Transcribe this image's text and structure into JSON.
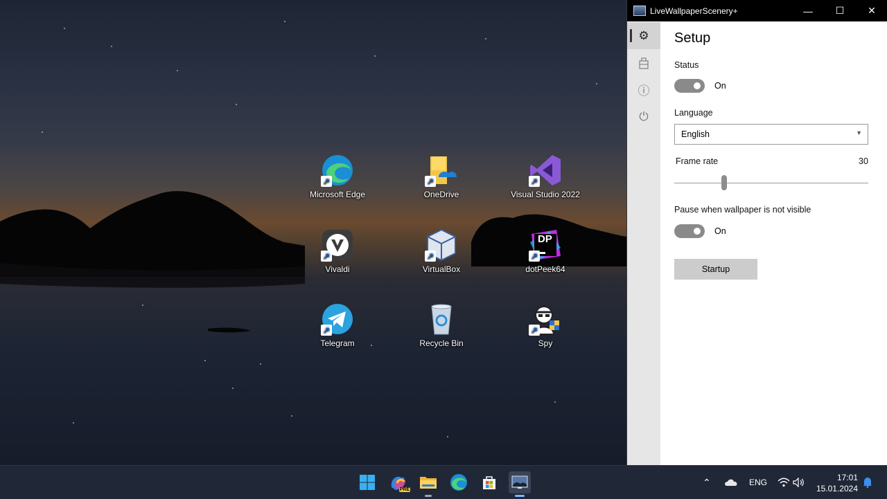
{
  "window": {
    "title": "LiveWallpaperScenery+",
    "controls": {
      "minimize": "—",
      "maximize": "☐",
      "close": "✕"
    }
  },
  "nav": {
    "items": [
      {
        "name": "settings",
        "icon": "gear-icon",
        "glyph": "⚙",
        "active": true
      },
      {
        "name": "store",
        "icon": "bag-icon",
        "glyph": "⛀",
        "active": false
      },
      {
        "name": "about",
        "icon": "info-icon",
        "glyph": "ⓘ",
        "active": false
      },
      {
        "name": "power",
        "icon": "power-icon",
        "glyph": "⏻",
        "active": false
      }
    ]
  },
  "setup": {
    "heading": "Setup",
    "status": {
      "label": "Status",
      "value": "On",
      "enabled": true
    },
    "language": {
      "label": "Language",
      "selected": "English"
    },
    "frame_rate": {
      "label": "Frame rate",
      "value": "30",
      "position_fraction": 0.25
    },
    "pause": {
      "label": "Pause when wallpaper is not visible",
      "value": "On",
      "enabled": true
    },
    "startup_button": "Startup"
  },
  "desktop": {
    "icons": [
      {
        "label": "Microsoft Edge",
        "icon": "edge-icon",
        "shortcut": true
      },
      {
        "label": "OneDrive",
        "icon": "onedrive-folder-icon",
        "shortcut": true
      },
      {
        "label": "Visual Studio 2022",
        "icon": "visual-studio-icon",
        "shortcut": true
      },
      {
        "label": "Vivaldi",
        "icon": "vivaldi-icon",
        "shortcut": true
      },
      {
        "label": "VirtualBox",
        "icon": "virtualbox-icon",
        "shortcut": true
      },
      {
        "label": "dotPeek64",
        "icon": "dotpeek-icon",
        "shortcut": true,
        "badge": "DP"
      },
      {
        "label": "Telegram",
        "icon": "telegram-icon",
        "shortcut": true
      },
      {
        "label": "Recycle Bin",
        "icon": "recycle-bin-icon",
        "shortcut": false
      },
      {
        "label": "Spy",
        "icon": "spy-icon",
        "shortcut": true
      }
    ]
  },
  "taskbar": {
    "apps": [
      {
        "name": "start",
        "icon": "windows-start-icon"
      },
      {
        "name": "copilot",
        "icon": "copilot-icon",
        "badge": "PRE"
      },
      {
        "name": "file-explorer",
        "icon": "folder-icon"
      },
      {
        "name": "edge",
        "icon": "edge-icon"
      },
      {
        "name": "store",
        "icon": "store-icon"
      },
      {
        "name": "livewallpaper",
        "icon": "wallpaper-app-icon",
        "active": true
      }
    ],
    "tray": {
      "chevron": "⌃",
      "language": "ENG",
      "time": "17:01",
      "date": "15.01.2024"
    }
  },
  "colors": {
    "toggle_on": "#8a8a8a",
    "taskbar": "#202838",
    "nav_bg": "#e6e6e6"
  }
}
